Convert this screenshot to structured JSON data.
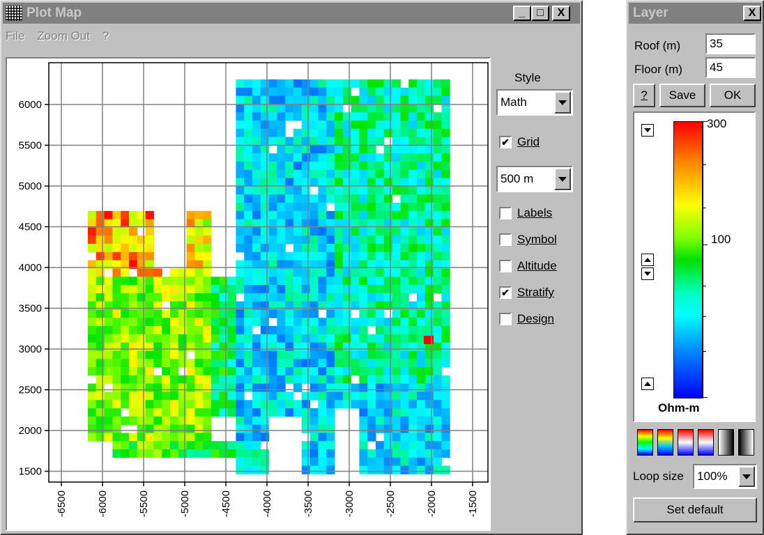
{
  "plot_window": {
    "title": "Plot Map",
    "menu": [
      "File",
      "Zoom Out",
      "?"
    ],
    "buttons": {
      "minimize": "_",
      "maximize": "□",
      "close": "X"
    },
    "style_label": "Style",
    "style_value": "Math",
    "grid_label": "Grid",
    "grid_checked": true,
    "grid_spacing": "500 m",
    "options": [
      {
        "label": "Labels",
        "checked": false
      },
      {
        "label": "Symbol",
        "checked": false
      },
      {
        "label": "Altitude",
        "checked": false
      },
      {
        "label": "Stratify",
        "checked": true
      },
      {
        "label": "Design",
        "checked": false
      }
    ],
    "map": {
      "y_ticks": [
        "6000",
        "5500",
        "5000",
        "4500",
        "4000",
        "3500",
        "3000",
        "2500",
        "2000",
        "1500"
      ],
      "x_ticks": [
        "-6500",
        "-6000",
        "-5500",
        "-5000",
        "-4500",
        "-4000",
        "-3500",
        "-3000",
        "-2500",
        "-2000",
        "-1500"
      ],
      "colormap": "blue-cyan-green-yellow-red",
      "anomaly_color": "#ff0000"
    }
  },
  "layer_window": {
    "title": "Layer",
    "close": "X",
    "roof_label": "Roof (m)",
    "roof_value": "35",
    "floor_label": "Floor (m)",
    "floor_value": "45",
    "help_button": "?",
    "save_button": "Save",
    "ok_button": "OK",
    "scale_max": "300",
    "scale_mid": "100",
    "unit": "Ohm-m",
    "loop_size_label": "Loop size",
    "loop_size_value": "100%",
    "set_default_button": "Set default"
  }
}
